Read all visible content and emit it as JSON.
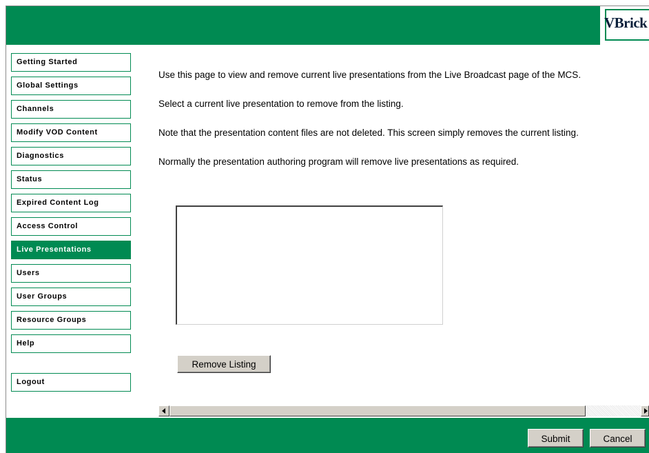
{
  "brand": {
    "logo_text": "VBrick",
    "accent_color": "#008a52"
  },
  "sidebar": {
    "items": [
      {
        "label": "Getting Started",
        "active": false
      },
      {
        "label": "Global Settings",
        "active": false
      },
      {
        "label": "Channels",
        "active": false
      },
      {
        "label": "Modify VOD Content",
        "active": false
      },
      {
        "label": "Diagnostics",
        "active": false
      },
      {
        "label": "Status",
        "active": false
      },
      {
        "label": "Expired Content Log",
        "active": false
      },
      {
        "label": "Access Control",
        "active": false
      },
      {
        "label": "Live Presentations",
        "active": true
      },
      {
        "label": "Users",
        "active": false
      },
      {
        "label": "User Groups",
        "active": false
      },
      {
        "label": "Resource Groups",
        "active": false
      },
      {
        "label": "Help",
        "active": false
      }
    ],
    "logout_label": "Logout"
  },
  "main": {
    "paragraphs": [
      "Use this page to view and remove current live presentations from the Live Broadcast page of the MCS.",
      "Select a current live presentation to remove from the listing.",
      "Note that the presentation content files are not deleted. This screen simply removes the current listing.",
      "Normally the presentation authoring program will remove live presentations as required."
    ],
    "remove_button_label": "Remove Listing"
  },
  "footer": {
    "submit_label": "Submit",
    "cancel_label": "Cancel"
  }
}
